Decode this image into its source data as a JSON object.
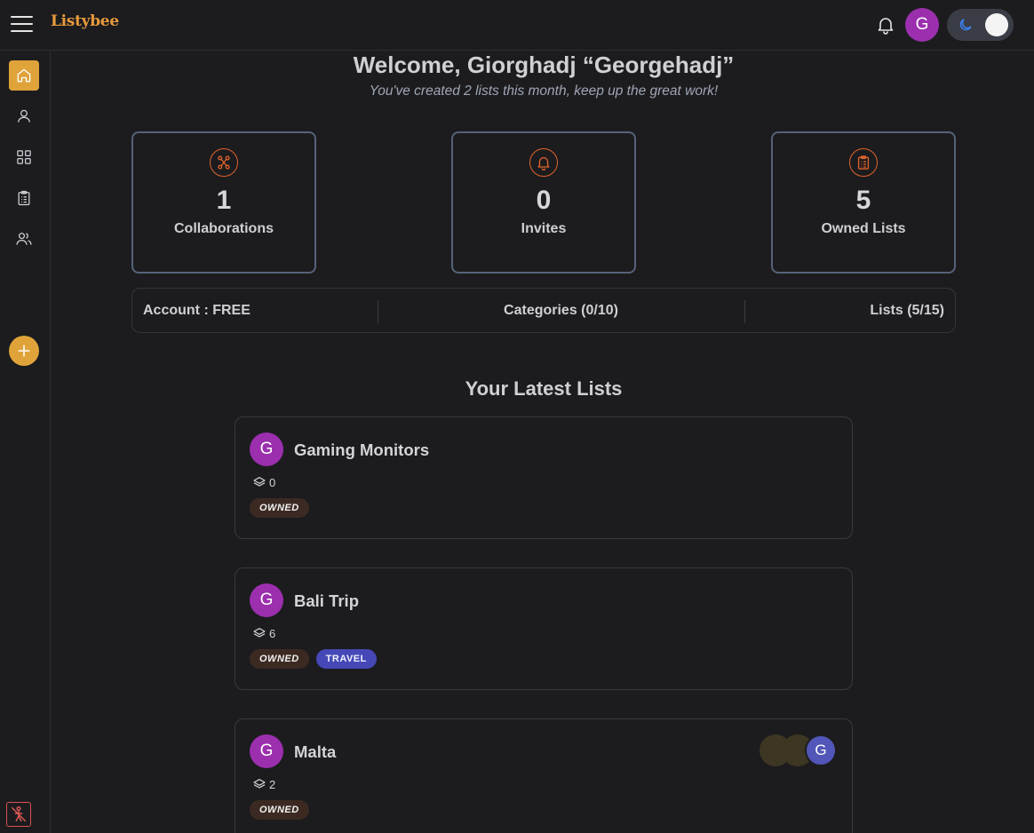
{
  "app": {
    "logo": "Listybee"
  },
  "header": {
    "avatar_initial": "G"
  },
  "welcome": {
    "title": "Welcome, Giorghadj “Georgehadj”",
    "subtitle": "You've created 2 lists this month, keep up the great work!"
  },
  "stats": [
    {
      "value": "1",
      "label": "Collaborations",
      "icon": "collaboration-icon"
    },
    {
      "value": "0",
      "label": "Invites",
      "icon": "bell-icon"
    },
    {
      "value": "5",
      "label": "Owned Lists",
      "icon": "clipboard-icon"
    }
  ],
  "account": {
    "plan": "Account : FREE",
    "categories": "Categories (0/10)",
    "lists": "Lists (5/15)"
  },
  "latest": {
    "title": "Your Latest Lists",
    "items": [
      {
        "initial": "G",
        "name": "Gaming Monitors",
        "count": "0",
        "tags": [
          "OWNED"
        ]
      },
      {
        "initial": "G",
        "name": "Bali Trip",
        "count": "6",
        "tags": [
          "OWNED",
          "TRAVEL"
        ]
      },
      {
        "initial": "G",
        "name": "Malta",
        "count": "2",
        "tags": [
          "OWNED"
        ],
        "collaborator_initial": "G"
      }
    ]
  },
  "colors": {
    "accent": "#e0a33a",
    "avatar": "#9b2fae",
    "icon_orange": "#e0622a",
    "card_border": "#56627a",
    "travel_tag": "#4548b6",
    "owned_tag": "#3c2a22"
  }
}
